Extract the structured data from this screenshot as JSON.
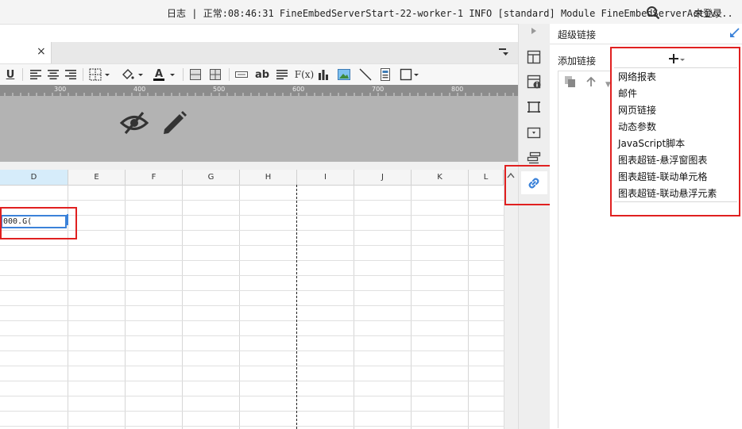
{
  "topbar": {
    "log_label": "日志",
    "log_message": " | 正常:08:46:31 FineEmbedServerStart-22-worker-1 INFO [standard] Module FineEmbedServerActiv...",
    "login": "未登录"
  },
  "tabbar": {
    "close": "×"
  },
  "toolbar": {
    "underline": "U",
    "text_ab": "ab",
    "formula": "F(x)"
  },
  "ruler": {
    "labels": [
      "300",
      "400",
      "500",
      "600",
      "700",
      "800"
    ]
  },
  "sheet": {
    "columns": [
      "D",
      "E",
      "F",
      "G",
      "H",
      "I",
      "J",
      "K",
      "L"
    ],
    "cell_d3": "000.G("
  },
  "panel": {
    "title": "超级链接",
    "add_link": "添加链接",
    "add_button": "+",
    "menu_items": [
      "网络报表",
      "邮件",
      "网页链接",
      "动态参数",
      "JavaScript脚本",
      "图表超链-悬浮窗图表",
      "图表超链-联动单元格",
      "图表超链-联动悬浮元素"
    ]
  },
  "colors": {
    "accent": "#3b82d9",
    "highlight": "#e02020"
  }
}
